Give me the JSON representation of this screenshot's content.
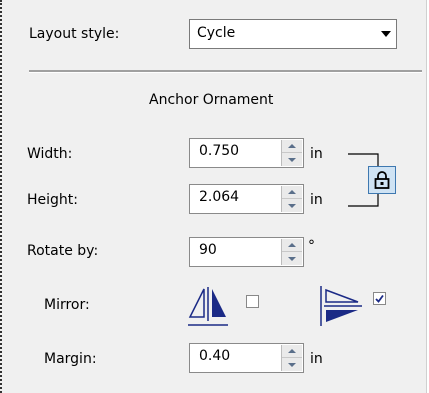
{
  "layout_style": {
    "label": "Layout style:",
    "value": "Cycle"
  },
  "section_title": "Anchor Ornament",
  "width": {
    "label": "Width:",
    "value": "0.750",
    "unit": "in"
  },
  "height": {
    "label": "Height:",
    "value": "2.064",
    "unit": "in"
  },
  "rotate": {
    "label": "Rotate by:",
    "value": "90",
    "unit": "°"
  },
  "mirror": {
    "label": "Mirror:",
    "horizontal": {
      "icon": "mirror-horizontal-icon",
      "checked": false
    },
    "vertical": {
      "icon": "mirror-vertical-icon",
      "checked": true
    }
  },
  "margin": {
    "label": "Margin:",
    "value": "0.40",
    "unit": "in"
  },
  "icons": {
    "lock": "lock-icon",
    "dropdown": "chevron-down-icon"
  },
  "colors": {
    "lock_bg": "#cfe3f4",
    "lock_border": "#3e78b0",
    "mirror_icon": "#1b2a86"
  }
}
